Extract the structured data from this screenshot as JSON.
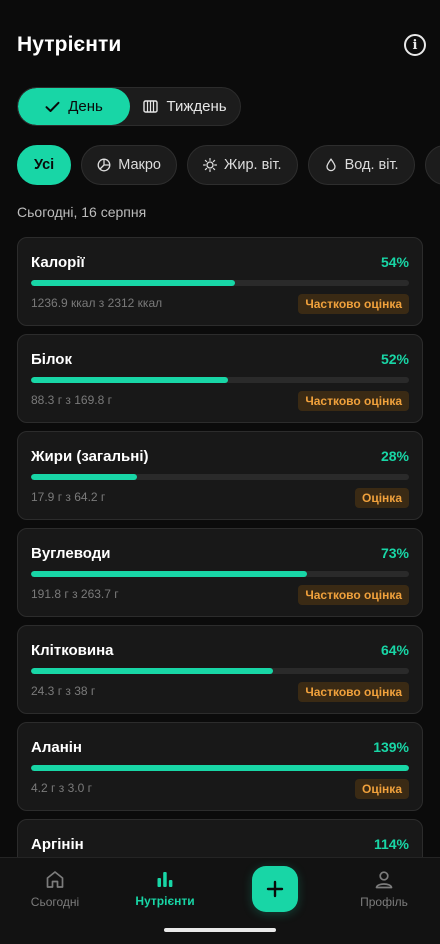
{
  "header": {
    "title": "Нутрієнти",
    "info_icon": "info-icon"
  },
  "segment": {
    "day_label": "День",
    "week_label": "Тиждень",
    "selected": "day"
  },
  "chips": [
    {
      "label": "Усі",
      "icon": "",
      "active": true
    },
    {
      "label": "Макро",
      "icon": "pie-icon",
      "active": false
    },
    {
      "label": "Жир. віт.",
      "icon": "sun-icon",
      "active": false
    },
    {
      "label": "Вод. віт.",
      "icon": "drop-icon",
      "active": false
    },
    {
      "label": "",
      "icon": "sparkle-icon",
      "active": false
    }
  ],
  "date_label": "Сьогодні, 16 серпня",
  "nutrients": [
    {
      "name": "Калорії",
      "percent_text": "54%",
      "progress": 0.54,
      "amount": "1236.9 ккал з 2312 ккал",
      "badge": "Частково оцінка"
    },
    {
      "name": "Білок",
      "percent_text": "52%",
      "progress": 0.52,
      "amount": "88.3 г з 169.8 г",
      "badge": "Частково оцінка"
    },
    {
      "name": "Жири (загальні)",
      "percent_text": "28%",
      "progress": 0.28,
      "amount": "17.9 г з 64.2 г",
      "badge": "Оцінка"
    },
    {
      "name": "Вуглеводи",
      "percent_text": "73%",
      "progress": 0.73,
      "amount": "191.8 г з 263.7 г",
      "badge": "Частково оцінка"
    },
    {
      "name": "Клітковина",
      "percent_text": "64%",
      "progress": 0.64,
      "amount": "24.3 г з 38 г",
      "badge": "Частково оцінка"
    },
    {
      "name": "Аланін",
      "percent_text": "139%",
      "progress": 1.0,
      "amount": "4.2 г з 3.0 г",
      "badge": "Оцінка"
    },
    {
      "name": "Аргінін",
      "percent_text": "114%",
      "progress": 1.0,
      "amount": "",
      "badge": ""
    }
  ],
  "tabbar": {
    "today": "Сьогодні",
    "nutrients": "Нутрієнти",
    "profile": "Профіль"
  },
  "colors": {
    "accent": "#18d6a6",
    "badge_text": "#f0a13c",
    "background": "#0b0b0b"
  }
}
